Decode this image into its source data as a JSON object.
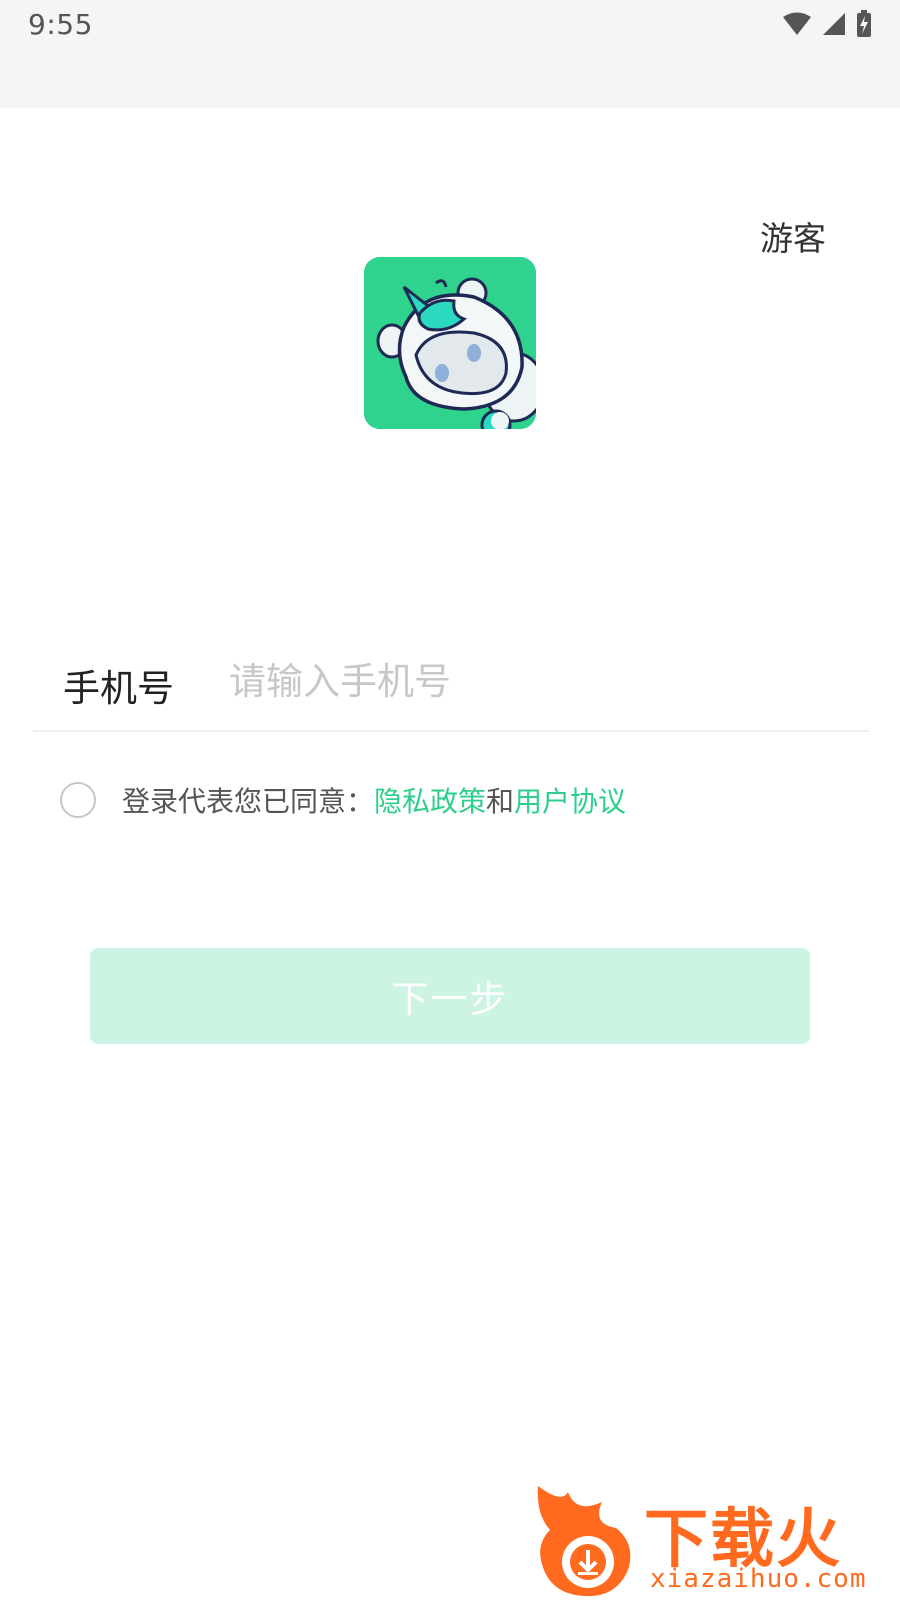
{
  "status_bar": {
    "time": "9:55",
    "icons": [
      "wifi-icon",
      "cellular-signal-icon",
      "battery-charging-icon"
    ]
  },
  "header": {
    "guest_label": "游客"
  },
  "logo": {
    "icon": "app-mascot-logo",
    "background_color": "#2fd38d"
  },
  "login_form": {
    "phone_label": "手机号",
    "phone_placeholder": "请输入手机号",
    "phone_value": "",
    "agreement": {
      "checked": false,
      "prefix_text": "登录代表您已同意：",
      "privacy_policy_label": "隐私政策",
      "conjunction": "和",
      "user_agreement_label": "用户协议",
      "link_color": "#2ecf8b"
    },
    "next_button_label": "下一步",
    "next_button_color": "#cdf3e2"
  },
  "watermark": {
    "title": "下载火",
    "site": "xiazaihuo.com",
    "color": "#ff6a1e"
  }
}
